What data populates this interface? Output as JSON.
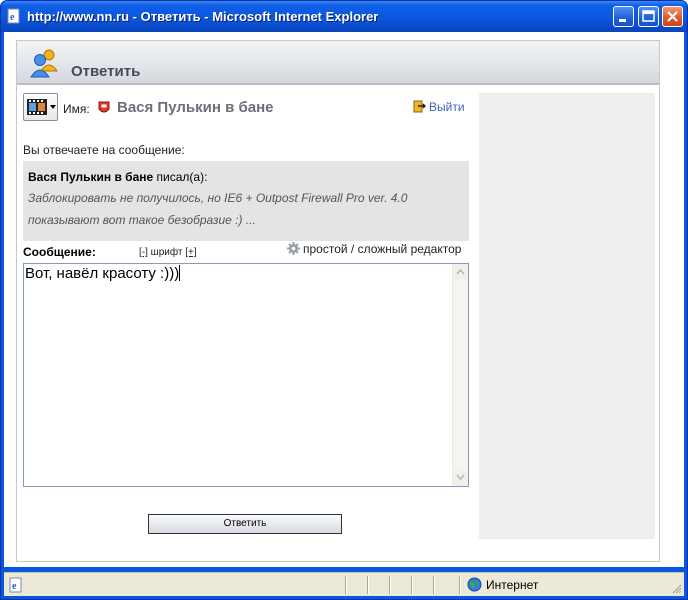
{
  "window": {
    "title": "http://www.nn.ru - Ответить - Microsoft Internet Explorer"
  },
  "panel": {
    "title": "Ответить"
  },
  "user": {
    "name_label": "Имя:",
    "name": "Вася Пулькин в бане",
    "logout_label": "Выйти"
  },
  "reply": {
    "intro": "Вы отвечаете на сообщение:",
    "quote_author": "Вася Пулькин в бане",
    "quote_wrote": " писал(а):",
    "quote_line1": "Заблокировать не получилось, но IE6 + Outpost Firewall Pro ver. 4.0",
    "quote_line2": "показывают вот такое безобразие :) ..."
  },
  "editor": {
    "message_label": "Сообщение:",
    "font_minus": "[-]",
    "font_label": " шрифт ",
    "font_plus": "[+]",
    "mode_switch": "простой / сложный редактор",
    "text": "Вот, навёл красоту :)))"
  },
  "submit_label": "Ответить",
  "statusbar": {
    "zone": "Интернет"
  },
  "colors": {
    "titlebar": "#0a58e0",
    "link": "#3b67b8",
    "quote_bg": "#e4e4e4",
    "sidebar_bg": "#eeeeee"
  }
}
